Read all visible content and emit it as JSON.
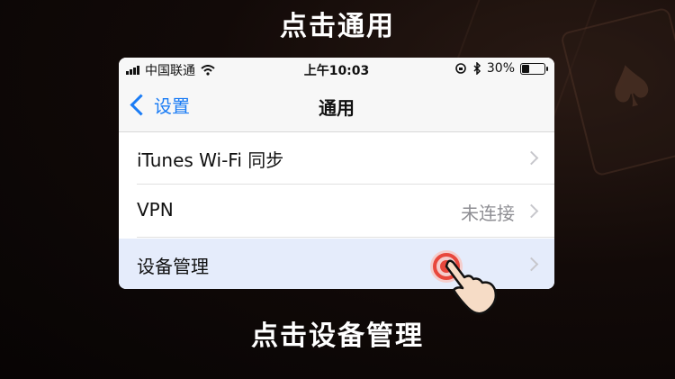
{
  "captions": {
    "top": "点击通用",
    "bottom": "点击设备管理"
  },
  "status_bar": {
    "carrier": "中国联通",
    "time": "上午10:03",
    "battery": "30%",
    "battery_level": 0.3
  },
  "nav": {
    "back_label": "设置",
    "title": "通用"
  },
  "rows": [
    {
      "label": "iTunes Wi-Fi 同步",
      "value": ""
    },
    {
      "label": "VPN",
      "value": "未连接"
    },
    {
      "label": "设备管理",
      "value": ""
    }
  ],
  "icons": {
    "signal": "signal-icon",
    "wifi": "wifi-icon",
    "rotation_lock": "rotation-lock-icon",
    "bluetooth": "bluetooth-icon",
    "battery": "battery-icon",
    "back": "chevron-left-icon",
    "disclosure": "chevron-right-icon",
    "tap": "tap-hand-icon"
  },
  "colors": {
    "accent": "#1a7cf5",
    "highlight_row": "#e5ecfb",
    "tap_ring": "#e8473c"
  }
}
